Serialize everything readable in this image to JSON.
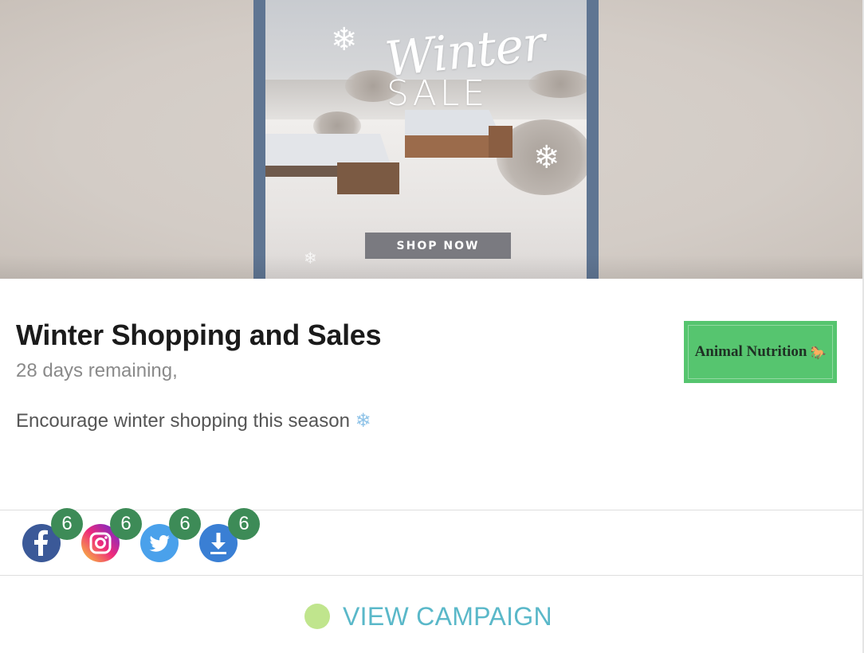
{
  "banner": {
    "headline_script": "Winter",
    "headline_sub": "SALE",
    "cta_label": "SHOP NOW"
  },
  "campaign": {
    "title": "Winter Shopping and Sales",
    "remaining": "28 days remaining,",
    "description": "Encourage winter shopping this season",
    "description_icon": "snowflake-emoji",
    "brand_name": "Animal Nutrition",
    "brand_icon": "horse-icon"
  },
  "socials": [
    {
      "network": "facebook",
      "icon": "facebook-icon",
      "count": "6",
      "color": "#3b5998"
    },
    {
      "network": "instagram",
      "icon": "instagram-icon",
      "count": "6",
      "color": "#d6249f"
    },
    {
      "network": "twitter",
      "icon": "twitter-icon",
      "count": "6",
      "color": "#4aa1eb"
    },
    {
      "network": "download",
      "icon": "download-icon",
      "count": "6",
      "color": "#3a7fd4"
    }
  ],
  "footer": {
    "view_label": "VIEW CAMPAIGN",
    "status_color": "#c0e58d",
    "link_color": "#5ab8c9"
  },
  "colors": {
    "badge": "#3d8b57",
    "brand_logo_bg": "#56c56f"
  }
}
